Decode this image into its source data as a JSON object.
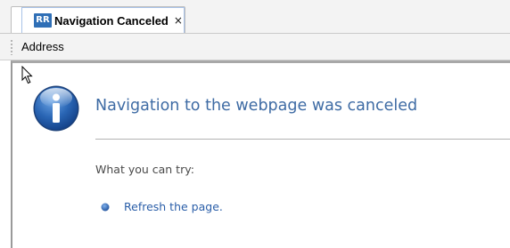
{
  "tab": {
    "badge": "RR",
    "title": "Navigation Canceled",
    "close_glyph": "×"
  },
  "address_bar": {
    "label": "Address"
  },
  "error_page": {
    "icon": "info-icon",
    "heading": "Navigation to the webpage was canceled",
    "try_text": "What you can try:",
    "suggestions": [
      {
        "label": "Refresh the page."
      }
    ]
  },
  "colors": {
    "heading": "#3e6ba4",
    "link": "#2a5ea8",
    "badge_bg": "#2f6fb6",
    "icon_blue": "#1f5aa8"
  }
}
